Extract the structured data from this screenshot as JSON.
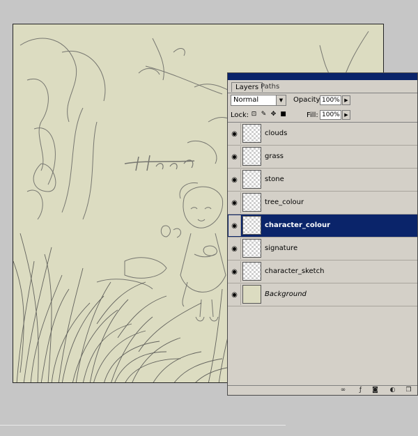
{
  "panel": {
    "tabs": [
      {
        "label": "Layers",
        "active": true
      },
      {
        "label": "Paths",
        "active": false
      }
    ],
    "blend_mode": "Normal",
    "opacity_label": "Opacity:",
    "opacity_value": "100%",
    "lock_label": "Lock:",
    "fill_label": "Fill:",
    "fill_value": "100%",
    "layers": [
      {
        "name": "clouds",
        "visible": true,
        "selected": false
      },
      {
        "name": "grass",
        "visible": true,
        "selected": false
      },
      {
        "name": "stone",
        "visible": true,
        "selected": false
      },
      {
        "name": "tree_colour",
        "visible": true,
        "selected": false
      },
      {
        "name": "character_colour",
        "visible": true,
        "selected": true
      },
      {
        "name": "signature",
        "visible": true,
        "selected": false
      },
      {
        "name": "character_sketch",
        "visible": true,
        "selected": false
      },
      {
        "name": "Background",
        "visible": true,
        "selected": false
      }
    ],
    "footer_icons": [
      "link-icon",
      "layer-style-icon",
      "mask-icon",
      "adjustment-icon",
      "new-layer-icon"
    ]
  },
  "colors": {
    "selection": "#0a246a",
    "panel_bg": "#d4d0c8",
    "canvas_bg": "#dcdcc1",
    "sketch_stroke": "#555555"
  }
}
